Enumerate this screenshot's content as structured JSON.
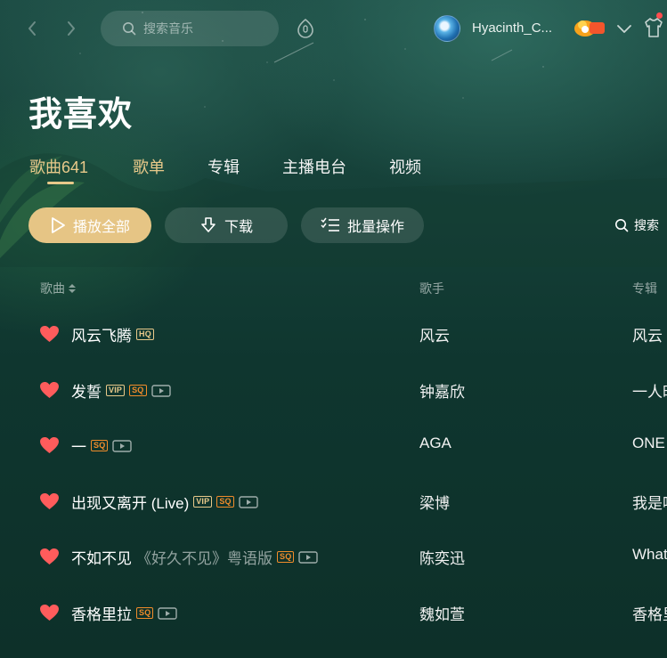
{
  "colors": {
    "accent_gold": "#e8c98a",
    "play_button": "#e6c585",
    "heart_red": "#ff5c5c",
    "sq_orange": "#f08c2b",
    "background": "#0e342d"
  },
  "topbar": {
    "back_icon": "chevron-left-icon",
    "forward_icon": "chevron-right-icon",
    "search_placeholder": "搜索音乐",
    "mic_icon": "mic-icon",
    "username": "Hyacinth_C...",
    "vip_badge_icon": "vip-badge-icon",
    "dropdown_icon": "chevron-down-icon",
    "skin_icon": "shirt-icon"
  },
  "header": {
    "title": "我喜欢",
    "tabs": [
      {
        "label": "歌曲641",
        "active": true
      },
      {
        "label": "歌单",
        "active": false
      },
      {
        "label": "专辑",
        "active": false
      },
      {
        "label": "主播电台",
        "active": false
      },
      {
        "label": "视频",
        "active": false
      }
    ]
  },
  "actions": {
    "play_all": "播放全部",
    "download": "下载",
    "batch": "批量操作",
    "search": "搜索"
  },
  "table": {
    "columns": {
      "song": "歌曲",
      "artist": "歌手",
      "album": "专辑"
    },
    "rows": [
      {
        "title": "风云飞腾",
        "extra": "",
        "tags": [
          "HQ"
        ],
        "mv": false,
        "artist": "风云",
        "album": "风云"
      },
      {
        "title": "发誓",
        "extra": "",
        "tags": [
          "VIP",
          "SQ"
        ],
        "mv": true,
        "artist": "钟嘉欣",
        "album": "一人时"
      },
      {
        "title": "一",
        "extra": "",
        "tags": [
          "SQ"
        ],
        "mv": true,
        "artist": "AGA",
        "album": "ONE"
      },
      {
        "title": "出现又离开 (Live)",
        "extra": "",
        "tags": [
          "VIP",
          "SQ"
        ],
        "mv": true,
        "artist": "梁博",
        "album": "我是唱"
      },
      {
        "title": "不如不见",
        "extra": "《好久不见》粤语版",
        "tags": [
          "SQ"
        ],
        "mv": true,
        "artist": "陈奕迅",
        "album": "What"
      },
      {
        "title": "香格里拉",
        "extra": "",
        "tags": [
          "SQ"
        ],
        "mv": true,
        "artist": "魏如萱",
        "album": "香格里"
      }
    ]
  }
}
